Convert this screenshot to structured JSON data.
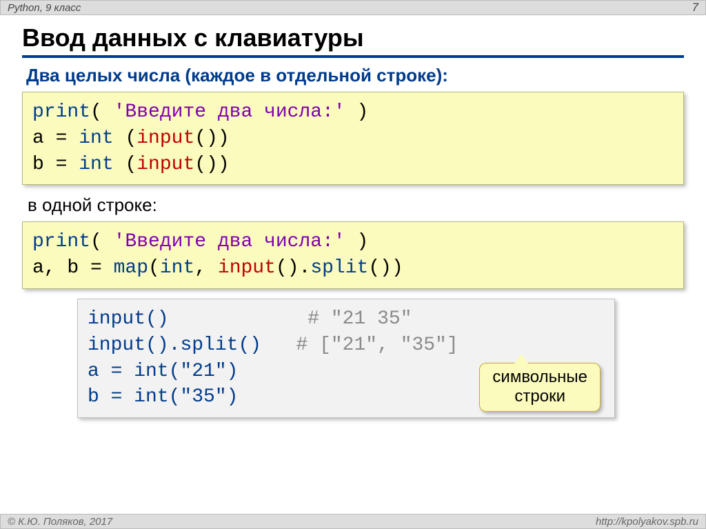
{
  "header": {
    "left": "Python, 9 класс",
    "page": "7"
  },
  "title": "Ввод данных с клавиатуры",
  "subtitle": "Два целых числа (каждое в отдельной строке):",
  "code1": {
    "print": "print",
    "str": "'Введите два числа:'",
    "line2a": "a = ",
    "line3a": "b = ",
    "int": "int",
    "input": "input",
    "lparen": " (",
    "rparen": "())"
  },
  "caption2": "в одной строке:",
  "code2": {
    "print": "print",
    "str": "'Введите два числа:'",
    "line2": "a, b = ",
    "map": "map",
    "int": "int",
    "input": "input",
    "split": "split"
  },
  "code3": {
    "l1a": "input",
    "l1b": "()            ",
    "c1": "# \"21 35\"",
    "l2a": "input",
    "l2b": "().",
    "l2c": "split",
    "l2d": "()   ",
    "c2": "# [\"21\", \"35\"]",
    "l3": "a = int(\"21\")",
    "l4": "b = int(\"35\")"
  },
  "callout": "символьные\nстроки",
  "footer": {
    "left": "© К.Ю. Поляков, 2017",
    "right": "http://kpolyakov.spb.ru"
  }
}
